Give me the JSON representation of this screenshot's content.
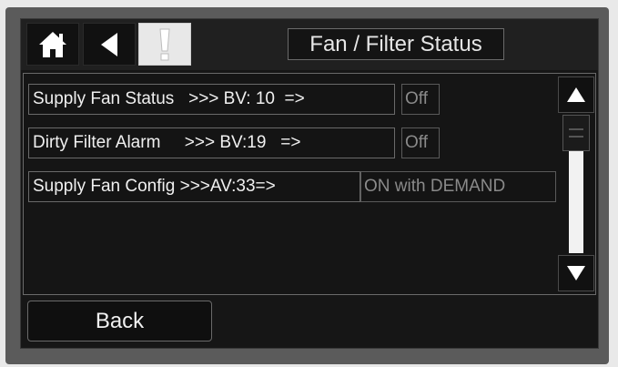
{
  "header": {
    "title": "Fan / Filter Status",
    "icons": [
      "home-icon",
      "back-arrow-icon",
      "alert-icon"
    ]
  },
  "rows": [
    {
      "label": "Supply Fan Status   >>> BV: 10  =>",
      "value": "Off"
    },
    {
      "label": "Dirty Filter Alarm     >>> BV:19   =>",
      "value": "Off"
    },
    {
      "label": "Supply Fan Config >>>AV:33=>",
      "value": "ON with DEMAND"
    }
  ],
  "scrollbar": {
    "up": "scroll-up-icon",
    "down": "scroll-down-icon"
  },
  "footer": {
    "back_label": "Back"
  },
  "colors": {
    "background": "#161616",
    "text": "#f0f0f0",
    "value_text": "#8a8a8a",
    "alert_button": "#e8e8e8"
  }
}
